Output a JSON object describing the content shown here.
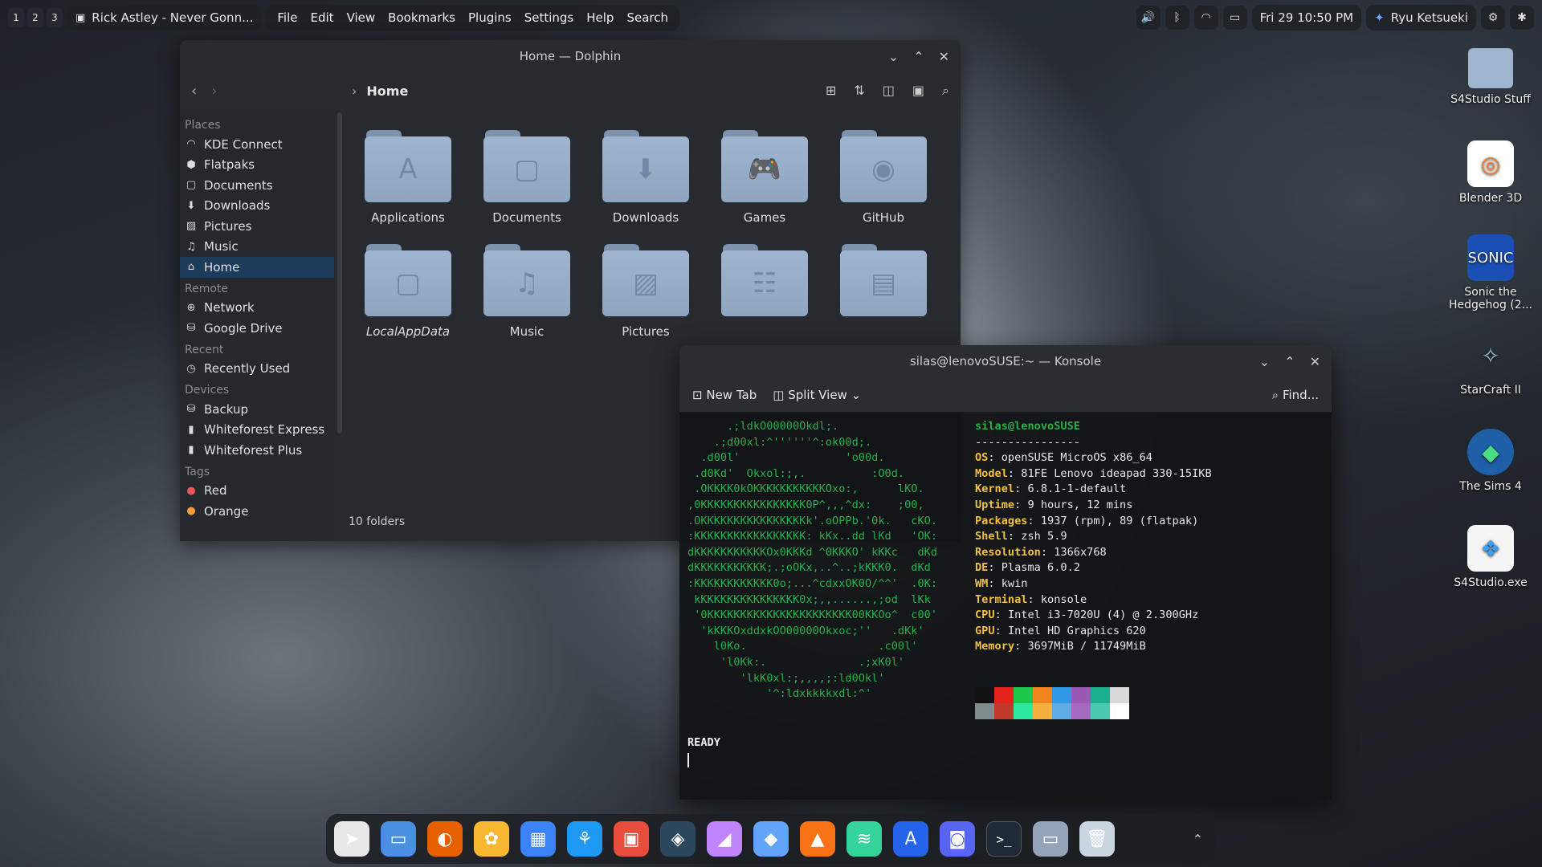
{
  "topbar": {
    "workspaces": [
      "1",
      "2",
      "3"
    ],
    "active_window": "Rick Astley - Never Gonn...",
    "menu": [
      "File",
      "Edit",
      "View",
      "Bookmarks",
      "Plugins",
      "Settings",
      "Help",
      "Search"
    ],
    "clock": "Fri 29  10:50 PM",
    "user": "Ryu Ketsueki"
  },
  "desktop_icons": [
    {
      "label": "S4Studio Stuff",
      "icon": "folder-icon"
    },
    {
      "label": "Blender 3D",
      "icon": "blender-icon"
    },
    {
      "label": "Sonic the Hedgehog (2...",
      "icon": "sonic-icon"
    },
    {
      "label": "StarCraft II",
      "icon": "starcraft-icon"
    },
    {
      "label": "The Sims 4",
      "icon": "sims-icon"
    },
    {
      "label": "S4Studio.exe",
      "icon": "s4studio-icon"
    }
  ],
  "dolphin": {
    "title": "Home — Dolphin",
    "crumb": "Home",
    "places": [
      {
        "type": "header",
        "label": "Places"
      },
      {
        "label": "KDE Connect",
        "icon": "wifi-icon"
      },
      {
        "label": "Flatpaks",
        "icon": "package-icon"
      },
      {
        "label": "Documents",
        "icon": "document-icon"
      },
      {
        "label": "Downloads",
        "icon": "download-icon"
      },
      {
        "label": "Pictures",
        "icon": "picture-icon"
      },
      {
        "label": "Music",
        "icon": "music-icon"
      },
      {
        "label": "Home",
        "icon": "home-icon",
        "selected": true
      },
      {
        "type": "header",
        "label": "Remote"
      },
      {
        "label": "Network",
        "icon": "network-icon"
      },
      {
        "label": "Google Drive",
        "icon": "drive-icon"
      },
      {
        "type": "header",
        "label": "Recent"
      },
      {
        "label": "Recently Used",
        "icon": "recent-icon"
      },
      {
        "type": "header",
        "label": "Devices"
      },
      {
        "label": "Backup",
        "icon": "drive-icon"
      },
      {
        "label": "Whiteforest Express",
        "icon": "usb-icon"
      },
      {
        "label": "Whiteforest Plus",
        "icon": "usb-icon"
      },
      {
        "type": "header",
        "label": "Tags"
      },
      {
        "label": "Red",
        "icon": "tag-icon",
        "color": "#e9545a"
      },
      {
        "label": "Orange",
        "icon": "tag-icon",
        "color": "#f39c3c"
      }
    ],
    "folders": [
      {
        "label": "Applications",
        "glyph": "A"
      },
      {
        "label": "Documents",
        "glyph": "▢"
      },
      {
        "label": "Downloads",
        "glyph": "⬇"
      },
      {
        "label": "Games",
        "glyph": "🎮"
      },
      {
        "label": "GitHub",
        "glyph": "◉"
      },
      {
        "label": "LocalAppData",
        "glyph": "▢",
        "italic": true
      },
      {
        "label": "Music",
        "glyph": "♫"
      },
      {
        "label": "Pictures",
        "glyph": "▨"
      },
      {
        "label": "",
        "glyph": "☷"
      },
      {
        "label": "",
        "glyph": "▤"
      }
    ],
    "status": "10 folders"
  },
  "konsole": {
    "title": "silas@lenovoSUSE:~ — Konsole",
    "new_tab": "New Tab",
    "split_view": "Split View",
    "find": "Find...",
    "logo": "      .;ldkO00000Okdl;.\n    .;d00xl:^''''''^:ok00d;.\n  .d00l'                'o00d.\n .d0Kd'  Okxol:;,.          :O0d.\n .OKKKK0kOKKKKKKKKKKKOxo:,      lKO.\n,0KKKKKKKKKKKKKKKK0P^,,,^dx:    ;00,\n.OKKKKKKKKKKKKKKKKk'.oOPPb.'0k.   cKO.\n:KKKKKKKKKKKKKKKKK: kKx..dd lKd   'OK:\ndKKKKKKKKKKKOx0KKKd ^0KKKO' kKKc   dKd\ndKKKKKKKKKKK;.;oOKx,..^..;kKKK0.  dKd\n:KKKKKKKKKKKK0o;...^cdxxOK0O/^^'  .0K:\n kKKKKKKKKKKKKKKK0x;,,......,;od  lKk\n '0KKKKKKKKKKKKKKKKKKKKKK00KKOo^  c00'\n  'kKKKOxddxkOO00000Okxoc;''   .dKk'\n    l0Ko.                    .c00l'\n     'l0Kk:.              .;xK0l'\n        'lkK0xl:;,,,,;:ld0Okl'\n            '^:ldxkkkkxdl:^'",
    "user_host": "silas@lenovoSUSE",
    "separator": "----------------",
    "info": [
      {
        "key": "OS",
        "value": "openSUSE MicroOS x86_64"
      },
      {
        "key": "Model",
        "value": "81FE Lenovo ideapad 330-15IKB"
      },
      {
        "key": "Kernel",
        "value": "6.8.1-1-default"
      },
      {
        "key": "Uptime",
        "value": "9 hours, 12 mins"
      },
      {
        "key": "Packages",
        "value": "1937 (rpm), 89 (flatpak)"
      },
      {
        "key": "Shell",
        "value": "zsh 5.9"
      },
      {
        "key": "Resolution",
        "value": "1366x768"
      },
      {
        "key": "DE",
        "value": "Plasma 6.0.2"
      },
      {
        "key": "WM",
        "value": "kwin"
      },
      {
        "key": "Terminal",
        "value": "konsole"
      },
      {
        "key": "CPU",
        "value": "Intel i3-7020U (4) @ 2.300GHz"
      },
      {
        "key": "GPU",
        "value": "Intel HD Graphics 620"
      },
      {
        "key": "Memory",
        "value": "3697MiB / 11749MiB"
      }
    ],
    "palette_top": [
      "#111111",
      "#e5231d",
      "#1ec84a",
      "#f2841d",
      "#2f9be8",
      "#9b59b6",
      "#1aaf8e",
      "#d9d9d9"
    ],
    "palette_bottom": [
      "#7f8c8d",
      "#c0392b",
      "#2ee8a0",
      "#f5b041",
      "#5dade2",
      "#a569bd",
      "#48c9b0",
      "#ffffff"
    ],
    "ready": "READY"
  },
  "dock": [
    {
      "name": "launcher-icon",
      "color": "#e8e8e8",
      "glyph": "➤"
    },
    {
      "name": "files-icon",
      "color": "#4a90e2",
      "glyph": "▭"
    },
    {
      "name": "firefox-icon",
      "color": "#e66000",
      "glyph": "◐"
    },
    {
      "name": "photos-icon",
      "color": "#f7b731",
      "glyph": "✿"
    },
    {
      "name": "calendar-icon",
      "color": "#3b82f6",
      "glyph": "▦"
    },
    {
      "name": "kde-connect-icon",
      "color": "#1d99f3",
      "glyph": "⚘"
    },
    {
      "name": "apps-icon",
      "color": "#e74c3c",
      "glyph": "▣"
    },
    {
      "name": "steam-icon",
      "color": "#2a475e",
      "glyph": "◈"
    },
    {
      "name": "paint-icon",
      "color": "#c084fc",
      "glyph": "◢"
    },
    {
      "name": "office-icon",
      "color": "#60a5fa",
      "glyph": "◆"
    },
    {
      "name": "vlc-icon",
      "color": "#f97316",
      "glyph": "▲"
    },
    {
      "name": "layers-icon",
      "color": "#34d399",
      "glyph": "≋"
    },
    {
      "name": "store-icon",
      "color": "#2563eb",
      "glyph": "A"
    },
    {
      "name": "discord-icon",
      "color": "#5865f2",
      "glyph": "◙"
    },
    {
      "name": "terminal-icon",
      "color": "#1f2937",
      "glyph": ">_"
    },
    {
      "name": "folder-icon",
      "color": "#94a3b8",
      "glyph": "▭"
    },
    {
      "name": "trash-icon",
      "color": "#cbd5e1",
      "glyph": "🗑"
    }
  ]
}
